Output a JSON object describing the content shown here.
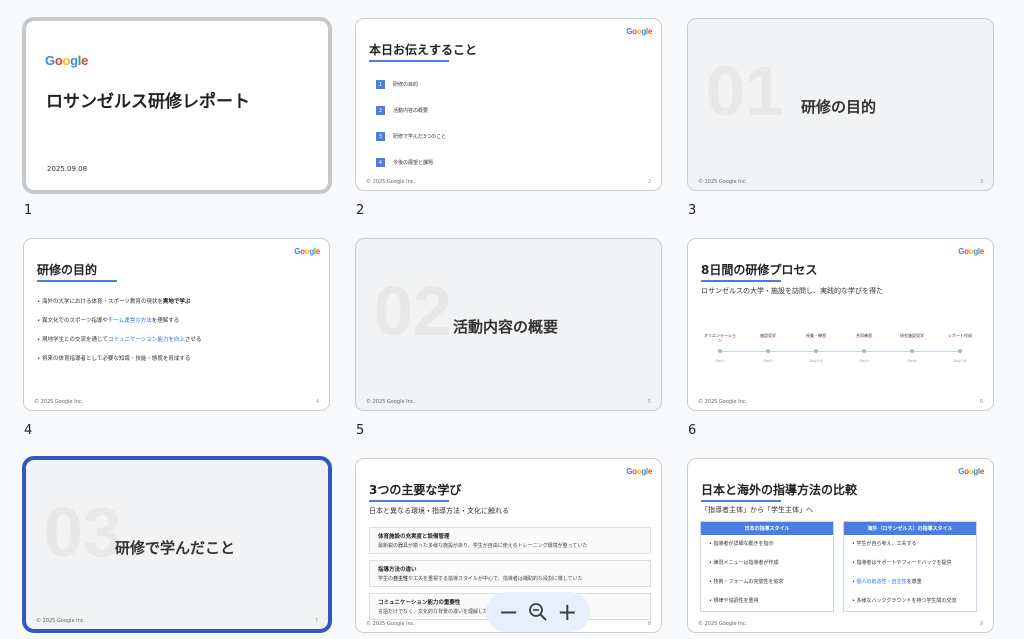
{
  "google_logo": [
    "G",
    "o",
    "o",
    "g",
    "l",
    "e"
  ],
  "footer_text": "© 2025 Google Inc.",
  "zoom": {
    "minus": "−",
    "plus": "+"
  },
  "colors": {
    "accent": "#4a7fe0",
    "selection": "#2d5bbd",
    "logo_blue": "#4285f4",
    "logo_red": "#ea4335",
    "logo_yellow": "#fbbc05",
    "logo_green": "#34a853"
  },
  "slides": [
    {
      "number": "1",
      "title": "ロサンゼルス研修レポート",
      "date": "2025.09.08"
    },
    {
      "number": "2",
      "title": "本日お伝えすること",
      "page": "2",
      "items": [
        {
          "n": "1",
          "label": "研修の目的"
        },
        {
          "n": "2",
          "label": "活動内容の概要"
        },
        {
          "n": "3",
          "label": "研修で学んだ3つのこと"
        },
        {
          "n": "4",
          "label": "今後の展望と課題"
        }
      ]
    },
    {
      "number": "3",
      "big": "01",
      "title": "研修の目的",
      "page": "3"
    },
    {
      "number": "4",
      "title": "研修の目的",
      "page": "4",
      "bullets": [
        {
          "pre": "• 海外の大学における体育・スポーツ教育の現状を",
          "em": "実地で学ぶ",
          "post": ""
        },
        {
          "pre": "• 異文化でのスポーツ指導や",
          "em": "チーム運営の方法",
          "post": "を理解する"
        },
        {
          "pre": "• 現地学生との交流を通じて",
          "em": "コミュニケーション能力を向上",
          "post": "させる"
        },
        {
          "pre": "• 将来の体育指導者として必要な知識・技能・態度を育成する",
          "em": "",
          "post": ""
        }
      ]
    },
    {
      "number": "5",
      "big": "02",
      "title": "活動内容の概要",
      "page": "5"
    },
    {
      "number": "6",
      "title": "8日間の研修プロセス",
      "subtitle": "ロサンゼルスの大学・施設を訪問し、実践的な学びを得た",
      "page": "6",
      "steps": [
        {
          "label": "オリエンテーション",
          "day": "Day1"
        },
        {
          "label": "施設見学",
          "day": "Day2"
        },
        {
          "label": "授業・練習",
          "day": "Day3-4"
        },
        {
          "label": "合同練習",
          "day": "Day5"
        },
        {
          "label": "研究施設見学",
          "day": "Day6"
        },
        {
          "label": "レポート作成",
          "day": "Day7-8"
        }
      ]
    },
    {
      "number": "7",
      "big": "03",
      "title": "研修で学んだこと",
      "page": "7"
    },
    {
      "number": "8",
      "title": "3つの主要な学び",
      "subtitle": "日本と異なる環境・指導方法・文化に触れる",
      "page": "8",
      "learnings": [
        {
          "title": "体育施設の充実度と設備管理",
          "desc": "最新鋭の器具が揃った多様な施設があり、学生が自由に使えるトレーニング環境が整っていた"
        },
        {
          "title": "指導方法の違い",
          "desc_pre": "学生の",
          "desc_em": "自主性",
          "desc_mid": "や工夫を重視する指導スタイルが中心で、指導者は補助的な役割に徹していた"
        },
        {
          "title": "コミュニケーション能力の重要性",
          "desc": "言語だけでなく、文化的な背景の違いを理解した"
        }
      ]
    },
    {
      "number": "9",
      "title": "日本と海外の指導方法の比較",
      "subtitle": "「指導者主体」から「学生主体」へ",
      "page": "9",
      "left_header": "日本の指導スタイル",
      "left_items": [
        "• 指導者が詳細な動きを指示",
        "• 練習メニューは指導者が作成",
        "• 技術・フォームの完璧性を追求",
        "• 規律や協調性を重視"
      ],
      "right_header": "海外（ロサンゼルス）の指導スタイル",
      "right_items": [
        {
          "pre": "• 学生が自ら考え、工夫する",
          "em": ""
        },
        {
          "pre": "• 指導者はサポートやフィードバックを提供",
          "em": ""
        },
        {
          "pre": "• ",
          "em": "個人の創造性・自主性",
          "post": "を尊重"
        },
        {
          "pre": "• 多様なバックグラウンドを持つ学生間の交流",
          "em": ""
        }
      ]
    }
  ]
}
